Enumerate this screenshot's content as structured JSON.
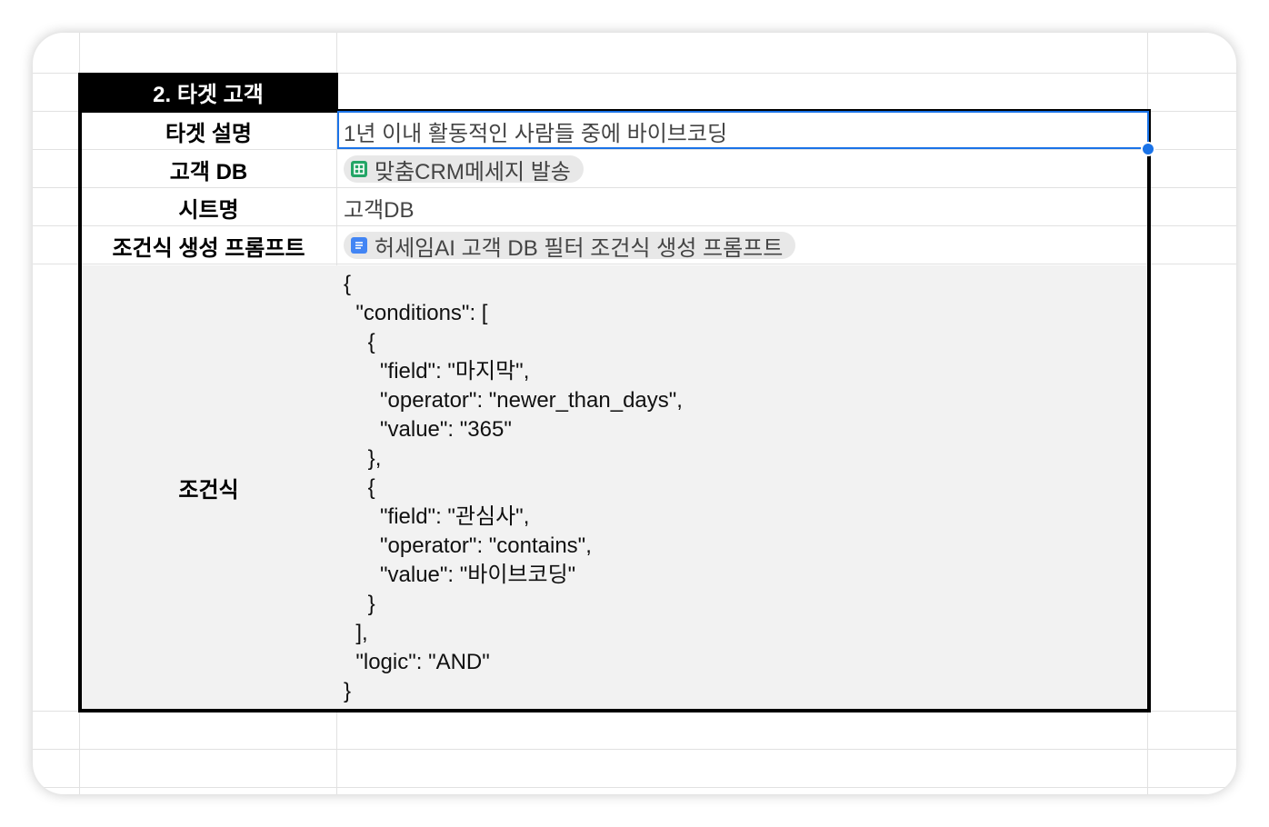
{
  "section": {
    "header": "2. 타겟 고객"
  },
  "rows": [
    {
      "label": "타겟 설명",
      "value": "1년 이내 활동적인 사람들 중에 바이브코딩"
    },
    {
      "label": "고객 DB",
      "chip": {
        "icon": "google-sheets-icon",
        "text": "맞춤CRM메세지 발송"
      }
    },
    {
      "label": "시트명",
      "value": "고객DB"
    },
    {
      "label": "조건식 생성 프롬프트",
      "chip": {
        "icon": "google-docs-icon",
        "text": "허세임AI 고객 DB 필터 조건식 생성 프롬프트"
      }
    },
    {
      "label": "조건식",
      "json": "{\n  \"conditions\": [\n    {\n      \"field\": \"마지막\",\n      \"operator\": \"newer_than_days\",\n      \"value\": \"365\"\n    },\n    {\n      \"field\": \"관심사\",\n      \"operator\": \"contains\",\n      \"value\": \"바이브코딩\"\n    }\n  ],\n  \"logic\": \"AND\"\n}"
    }
  ],
  "colors": {
    "selection": "#1a73e8",
    "sheets_green": "#23a566",
    "docs_blue": "#4285f4",
    "header_bg": "#000000"
  }
}
